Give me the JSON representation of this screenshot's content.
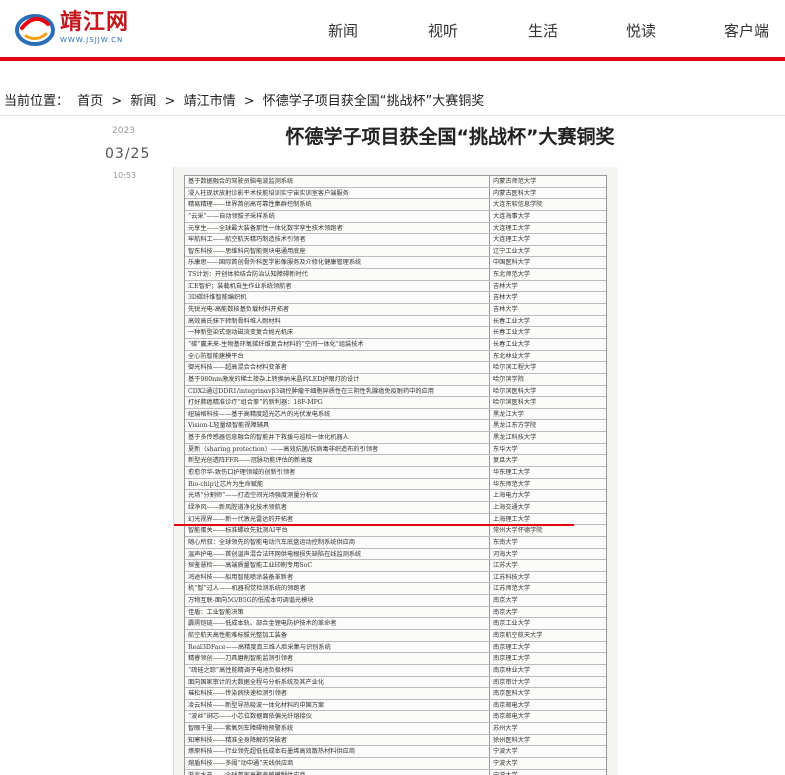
{
  "site": {
    "logo_cn": "靖江网",
    "logo_en": "WWW.JSJJW.CN"
  },
  "nav": {
    "items": [
      "新闻",
      "视听",
      "生活",
      "悦读",
      "客户端"
    ]
  },
  "breadcrumb": {
    "prefix": "当前位置：",
    "items": [
      "首页",
      "新闻",
      "靖江市情",
      "怀德学子项目获全国“挑战杯”大赛铜奖"
    ],
    "sep": ">"
  },
  "article": {
    "year": "2023",
    "month_day": "03/25",
    "time": "10:53",
    "title": "怀德学子项目获全国“挑战杯”大赛铜奖"
  },
  "table": {
    "rows": [
      [
        "基于数据融合的驾驶员脑电波监测系统",
        "内蒙古师范大学"
      ],
      [
        "浸入柱现状放射诊影平术技能培训实宁宙实训室客户端服务",
        "内蒙古医科大学"
      ],
      [
        "精易精理——世界首创高可靠性集群控制系统",
        "大连东软信息学院"
      ],
      [
        "“云采”——自动领拔子采样系统",
        "大连海事大学"
      ],
      [
        "元享生——全球最大装备那性一体化数字孪生技术领跑者",
        "大连理工大学"
      ],
      [
        "牢航科工——航空航天精巧制造技术引领者",
        "大连理工大学"
      ],
      [
        "智东科技——思维科向智能侧块电通用底座",
        "辽宁工业大学"
      ],
      [
        "乐康思——国际首创骨外科医学影像服务及介修化健康管理系统",
        "中国医科大学"
      ],
      [
        "TS计划：开创体验结合防治认知障碍新时代",
        "东北师范大学"
      ],
      [
        "汇E智护；装载机自生作业系统领航者",
        "吉林大学"
      ],
      [
        "3D碳纤维智能编织机",
        "吉林大学"
      ],
      [
        "先锐光电-高能数核基负载材料开拓者",
        "吉林大学"
      ],
      [
        "高效高氏抹下转制骨料堆人耐材料",
        "长春工业大学"
      ],
      [
        "一种新型染式驱动磁流变复合抛光机床",
        "长春工业大学"
      ],
      [
        "“碳”赢未来-生物基环氧碳纤维复合材料的“空间一体化”组装技术",
        "长春工业大学"
      ],
      [
        "全心防智能建模平台",
        "东北林业大学"
      ],
      [
        "御光科技——超高混合合材料变革者",
        "哈尔滨工程大学"
      ],
      [
        "基于980nm激发的稀土掺杂上转换纳米晶的LED护眼灯的设计",
        "哈尔滨学院"
      ],
      [
        "CDX2通过DDR1/integrinαvβ3调控肿瘤干细胞异质性在三阴性乳腺癌免疫耐药中的应用",
        "哈尔滨医科大学"
      ],
      [
        "打好肺癌精准诊疗“组合拳”的新利器：18F-MPG",
        "哈尔滨医科大学"
      ],
      [
        "纽瑞格科技——基于高精度超光芯片的光伏发电系统",
        "黑龙江大学"
      ],
      [
        "Vision-L轻量级智能视障辅具",
        "黑龙江东方学院"
      ],
      [
        "基于多传感器信息融合的智能井下救援与巡检一体化机器人",
        "黑龙江科技大学"
      ],
      [
        "夏新（sharing protection）——高效抗菌/抗病毒非织造布的引领者",
        "东华大学"
      ],
      [
        "新型光创透阵FFR——冠脉功能评估的新高度",
        "复旦大学"
      ],
      [
        "愈愈尔华-致伤口护理领域的创新引领者",
        "华东理工大学"
      ],
      [
        "Bio-chip让芯片为生命赋能",
        "华东师范大学"
      ],
      [
        "光场“分割师”——打造空间光场强度测量分析仪",
        "上海电力大学"
      ],
      [
        "绿净风——新风腔道净化技术领航者",
        "上海交通大学"
      ],
      [
        "幻光视界——新一代激光雷达的开拓者",
        "上海理工大学"
      ],
      [
        "智能蛋关——标准螺纹先批测AI平台",
        "常州大学怀德学院"
      ],
      [
        "随心所驭：全球领先的智能电动汽车底盘运动控制系统供应商",
        "东南大学"
      ],
      [
        "温声护电——首创温声混合法环网供电根损失缺陷在线监测系统",
        "河海大学"
      ],
      [
        "探鉴慧检——高端质量智能工业印刷专用SoC",
        "江苏大学"
      ],
      [
        "鸿途科技——船用智能喷涂装备革新者",
        "江苏科技大学"
      ],
      [
        "机“智”过人——机器视觉检测系统的领跑者",
        "江苏师范大学"
      ],
      [
        "万物互联-面向5G/B5G的低成本可调谐光模块",
        "南京大学"
      ],
      [
        "佳盾：工业智能决策",
        "南京大学"
      ],
      [
        "霹雳铠链——低成本轨、部合金锂电防护技术的革命者",
        "南京工业大学"
      ],
      [
        "航空航天高性能难标拔光整加工装备",
        "南京航空航天大学"
      ],
      [
        "Real3DFace——高精度真三维人脸采集与识别系统",
        "南京理工大学"
      ],
      [
        "精睿领创——刀具磨削智能监测引领者",
        "南京理工大学"
      ],
      [
        "“疏硅之踪”高性能精调子电池负极材料",
        "南京林业大学"
      ],
      [
        "面向国家审计的大数据全程与分析系统及其产业化",
        "南京审计大学"
      ],
      [
        "璀松科技——传染病快速检测引领者",
        "南京医科大学"
      ],
      [
        "凌云科技——新型导热吸波一体化材料的中国方案",
        "南京邮电大学"
      ],
      [
        "“波丝”绑芯——小芯位数据面依偏光纤熔接仪",
        "南京邮电大学"
      ],
      [
        "智眼千里——紫氧列车障碍物预警系统",
        "苏州大学"
      ],
      [
        "知寒科技——精准全身降解的突破者",
        "徐州医科大学"
      ],
      [
        "燎原科技——行业领先超低低成本石墨烯高效散热材料供应商",
        "宁波大学"
      ],
      [
        "熔盾科技——多阈“动中通”天线供应商",
        "宁波大学"
      ],
      [
        "浙兆水产——全球首家高聚养殖模糊供应商",
        "宁波大学"
      ]
    ]
  }
}
